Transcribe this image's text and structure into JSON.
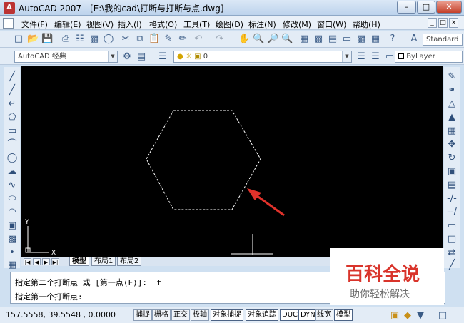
{
  "window": {
    "title": "AutoCAD 2007 - [E:\\我的cad\\打断与打断与点.dwg]",
    "app_icon_letter": "A"
  },
  "menu": {
    "items": [
      "文件(F)",
      "编辑(E)",
      "视图(V)",
      "插入(I)",
      "格式(O)",
      "工具(T)",
      "绘图(D)",
      "标注(N)",
      "修改(M)",
      "窗口(W)",
      "帮助(H)"
    ]
  },
  "toolbar": {
    "workspace_combo": "AutoCAD 经典",
    "layer_combo": "0",
    "text_style_combo": "Standard",
    "color_combo": "ByLayer"
  },
  "canvas": {
    "ucs_x_label": "X",
    "ucs_y_label": "Y"
  },
  "tabs": {
    "items": [
      "模型",
      "布局1",
      "布局2"
    ],
    "active": "模型"
  },
  "command": {
    "line1": "指定第二个打断点 或 [第一点(F)]: _f",
    "line2": "指定第一个打断点:"
  },
  "status": {
    "coordinates": "157.5558,  39.5548 , 0.0000",
    "buttons": [
      "捕捉",
      "栅格",
      "正交",
      "极轴",
      "对象捕捉",
      "对象追踪",
      "DUCS",
      "DYN",
      "线宽",
      "模型"
    ]
  },
  "watermark": {
    "title": "百科全说",
    "subtitle": "助你轻松解决"
  },
  "colors": {
    "canvas": "#000000",
    "hexagon_dashed": "#ffffff",
    "arrow": "#e0322b",
    "watermark_red": "#d9342b"
  }
}
